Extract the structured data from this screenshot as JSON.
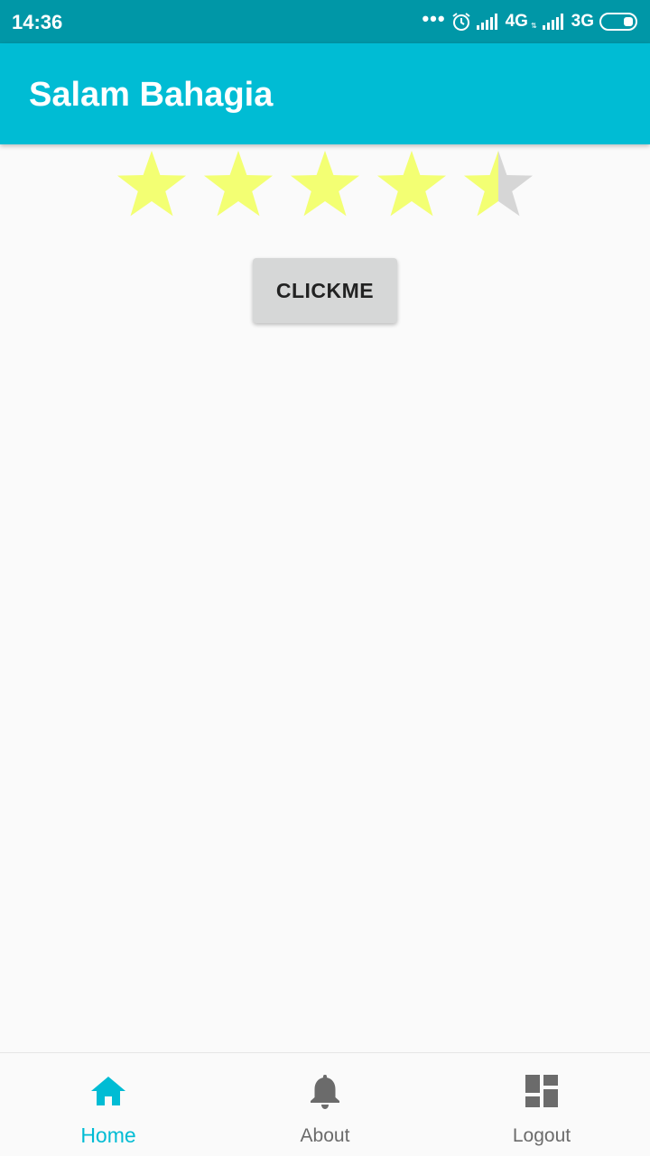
{
  "status_bar": {
    "time": "14:36",
    "dots": "•••",
    "network_1": "4G",
    "network_1_sub": "⇅",
    "network_2": "3G"
  },
  "app_bar": {
    "title": "Salam Bahagia"
  },
  "rating": {
    "value": 4.5,
    "max": 5,
    "filled_color": "#f3ff73",
    "empty_color": "#d6d6d6"
  },
  "main": {
    "button_label": "CLICKME"
  },
  "bottom_nav": {
    "active_color": "#00bcd4",
    "items": [
      {
        "label": "Home",
        "icon": "home-icon",
        "active": true
      },
      {
        "label": "About",
        "icon": "bell-icon",
        "active": false
      },
      {
        "label": "Logout",
        "icon": "dashboard-icon",
        "active": false
      }
    ]
  }
}
